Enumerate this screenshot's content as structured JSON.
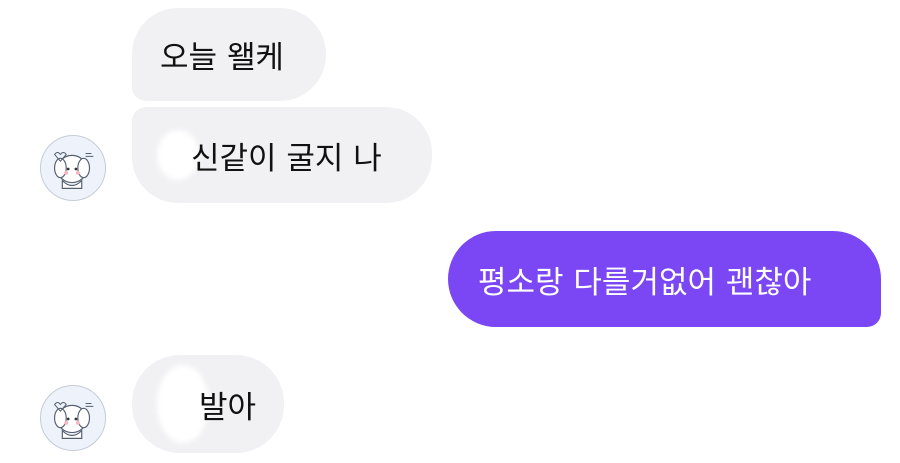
{
  "chat": {
    "messages": [
      {
        "sender": "other",
        "text": "오늘 왤케"
      },
      {
        "sender": "other",
        "text": "신같이 굴지 나"
      },
      {
        "sender": "me",
        "text": "평소랑 다를거없어 괜찮아"
      },
      {
        "sender": "other",
        "text": "발아"
      }
    ],
    "avatar_icon": "puppy-avatar-icon",
    "colors": {
      "incoming_bubble": "#f1f1f3",
      "outgoing_bubble": "#7b47f4",
      "outgoing_text": "#ffffff",
      "background": "#ffffff"
    }
  }
}
